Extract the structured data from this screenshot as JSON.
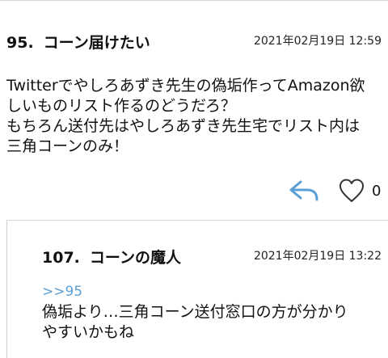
{
  "post": {
    "number": "95.",
    "name": "コーン届けたい",
    "date": "2021年02月19日 12:59",
    "body": "Twitterでやしろあずき先生の偽垢作ってAmazon欲\nしいものリスト作るのどうだろ？\nもちろん送付先はやしろあずき先生宅でリスト内は\n三角コーンのみ！",
    "like_count": "0"
  },
  "reply": {
    "number": "107.",
    "name": "コーンの魔人",
    "date": "2021年02月19日 13:22",
    "anchor": ">>95",
    "body": "偽垢より…三角コーン送付窓口の方が分かり\nやすいかもね"
  },
  "icons": {
    "reply": "reply-arrow-icon",
    "like": "heart-outline-icon"
  },
  "colors": {
    "accent": "#5aa0d6",
    "text": "#111111"
  }
}
